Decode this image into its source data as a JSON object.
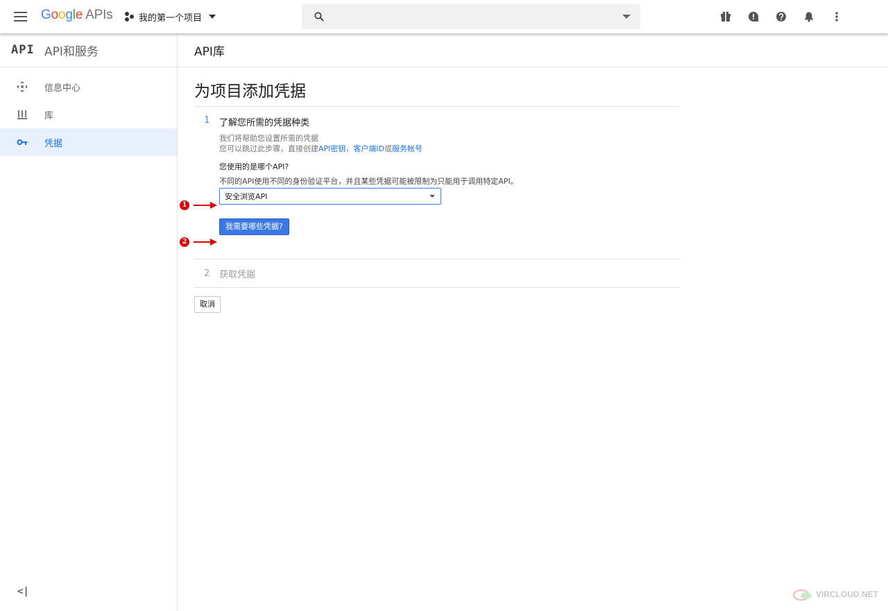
{
  "topbar": {
    "brand": {
      "g": "G",
      "o1": "o",
      "o2": "o",
      "g2": "g",
      "l": "l",
      "e": "e",
      "apis": "APIs"
    },
    "project_name": "我的第一个项目",
    "search_placeholder": ""
  },
  "sidebar": {
    "logo": "API",
    "title": "API和服务",
    "items": [
      {
        "label": "信息中心",
        "icon": "dashboard-icon"
      },
      {
        "label": "库",
        "icon": "library-icon"
      },
      {
        "label": "凭据",
        "icon": "key-icon"
      }
    ],
    "collapse_label": "<|"
  },
  "main": {
    "header_title": "API库",
    "page_title": "为项目添加凭据",
    "step1": {
      "number": "1",
      "title": "了解您所需的凭据种类",
      "help_line1": "我们将帮助您设置所需的凭据",
      "help_line2_prefix": "您可以跳过此步骤，直接创建",
      "link_api_key": "API密钥",
      "sep1": "，",
      "link_client_id": "客户端ID",
      "sep2": "或",
      "link_service_account": "服务帐号",
      "question": "您使用的是哪个API?",
      "question_desc": "不同的API使用不同的身份验证平台，并且某些凭据可能被限制为只能用于调用特定API。",
      "select_value": "安全浏览API",
      "button": "我需要哪些凭据?"
    },
    "step2": {
      "number": "2",
      "title": "获取凭据"
    },
    "cancel": "取消"
  },
  "annotations": {
    "badge1": "1",
    "badge2": "2"
  },
  "watermark": "VIRCLOUD.NET",
  "colors": {
    "accent": "#4285f4",
    "button": "#3b78e7",
    "annotation": "#e30000",
    "active_nav_bg": "#e8f0fe"
  }
}
